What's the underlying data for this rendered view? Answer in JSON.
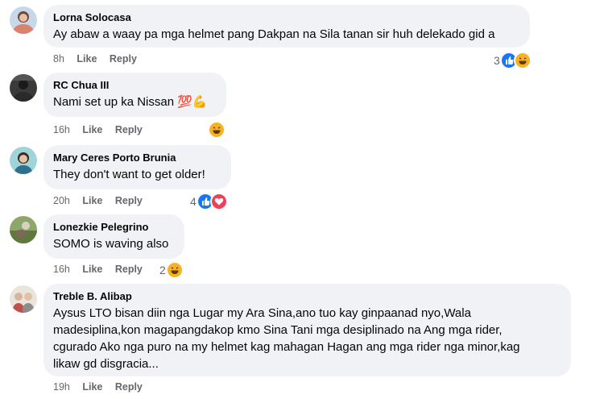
{
  "comments": [
    {
      "author": "Lorna Solocasa",
      "text": "Ay abaw a waay pa mga helmet pang Dakpan na Sila tanan sir huh delekado gid a",
      "time": "8h",
      "like": "Like",
      "reply": "Reply",
      "reaction_count": "3",
      "reactions": [
        "like-icon",
        "haha-icon"
      ]
    },
    {
      "author": "RC Chua III",
      "text": "Nami set up ka Nissan 💯💪",
      "time": "16h",
      "like": "Like",
      "reply": "Reply",
      "reaction_count": "",
      "reactions": [
        "haha-icon"
      ]
    },
    {
      "author": "Mary Ceres Porto Brunia",
      "text": "They don't want to get older!",
      "time": "20h",
      "like": "Like",
      "reply": "Reply",
      "reaction_count": "4",
      "reactions": [
        "like-icon",
        "love-icon"
      ]
    },
    {
      "author": "Lonezkie Pelegrino",
      "text": "SOMO is waving also",
      "time": "16h",
      "like": "Like",
      "reply": "Reply",
      "reaction_count": "2",
      "reactions": [
        "haha-icon"
      ]
    },
    {
      "author": "Treble B. Alibap",
      "text_lines": [
        "Aysus LTO bisan diin nga Lugar my Ara Sina,ano tuo kay ginpaanad nyo,Wala",
        "madesiplina,kon magapangdakop kmo Sina Tani mga desiplinado na Ang mga rider,",
        "cgurado Ako nga puro na my helmet kag mahagan Hagan ang mga rider nga minor,kag",
        "likaw gd disgracia..."
      ],
      "time": "19h",
      "like": "Like",
      "reply": "Reply"
    }
  ],
  "colors": {
    "bubble": "#f0f2f5",
    "like": "#1877f2",
    "haha": "#f7b125",
    "love": "#f33e58",
    "meta": "#65676b"
  }
}
